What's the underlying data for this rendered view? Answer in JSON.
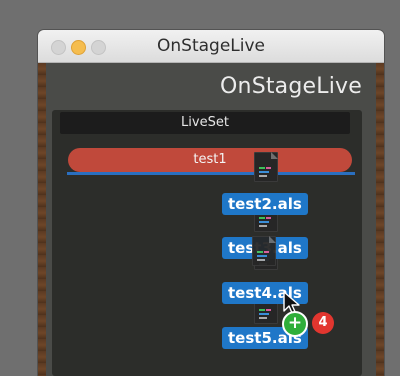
{
  "window": {
    "title": "OnStageLive",
    "brand": "OnStageLive"
  },
  "liveset": {
    "header": "LiveSet",
    "songs": [
      {
        "label": "test1"
      }
    ]
  },
  "drag": {
    "files": [
      "test2.als",
      "test3.als",
      "test4.als",
      "test5.als"
    ],
    "count": "4",
    "plus": "+"
  },
  "colors": {
    "song_bar": "#c0493b",
    "file_tag": "#1f77c8",
    "drop_indicator": "#2a6fc0",
    "badge_count": "#e2362f",
    "badge_plus": "#2fae3a"
  },
  "icons": [
    "close-button-icon",
    "minimize-button-icon",
    "zoom-button-icon",
    "document-icon",
    "arrow-cursor-icon",
    "plus-icon"
  ]
}
